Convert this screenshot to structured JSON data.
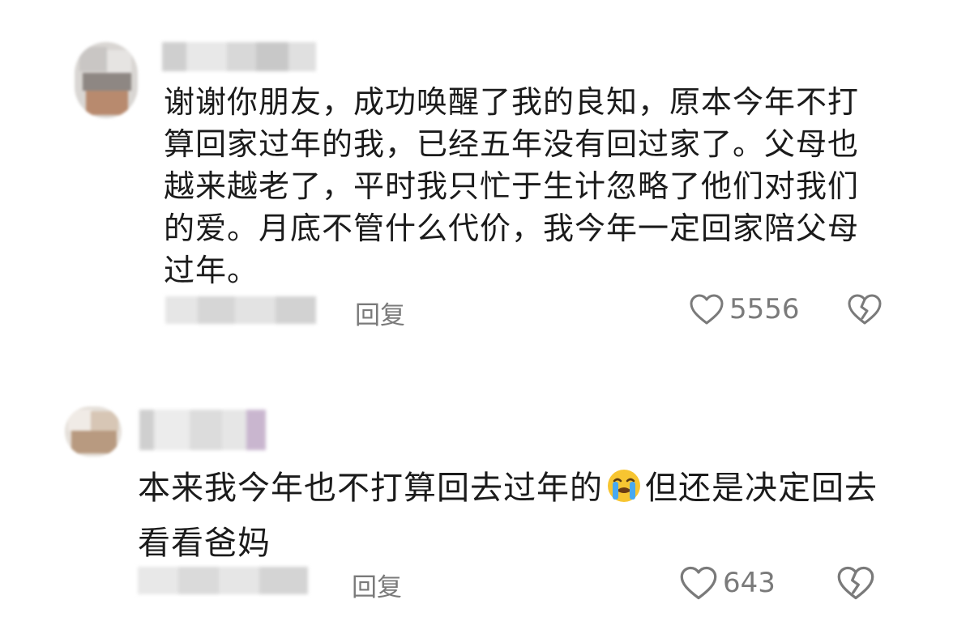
{
  "comments": [
    {
      "text": "谢谢你朋友，成功唤醒了我的良知，原本今年不打算回家过年的我，已经五年没有回过家了。父母也越来越老了，平时我只忙于生计忽略了他们对我们的爱。月底不管什么代价，我今年一定回家陪父母过年。",
      "reply_label": "回复",
      "likes": "5556"
    },
    {
      "text_before": "本来我今年也不打算回去过年的",
      "emoji": "loudly-crying-face",
      "text_after": "但还是决定回去看看爸妈",
      "reply_label": "回复",
      "likes": "643"
    }
  ],
  "icons": {
    "like": "heart-outline-icon",
    "dislike": "broken-heart-icon"
  },
  "colors": {
    "text": "#1b1b1b",
    "meta": "#7a7a7a"
  }
}
